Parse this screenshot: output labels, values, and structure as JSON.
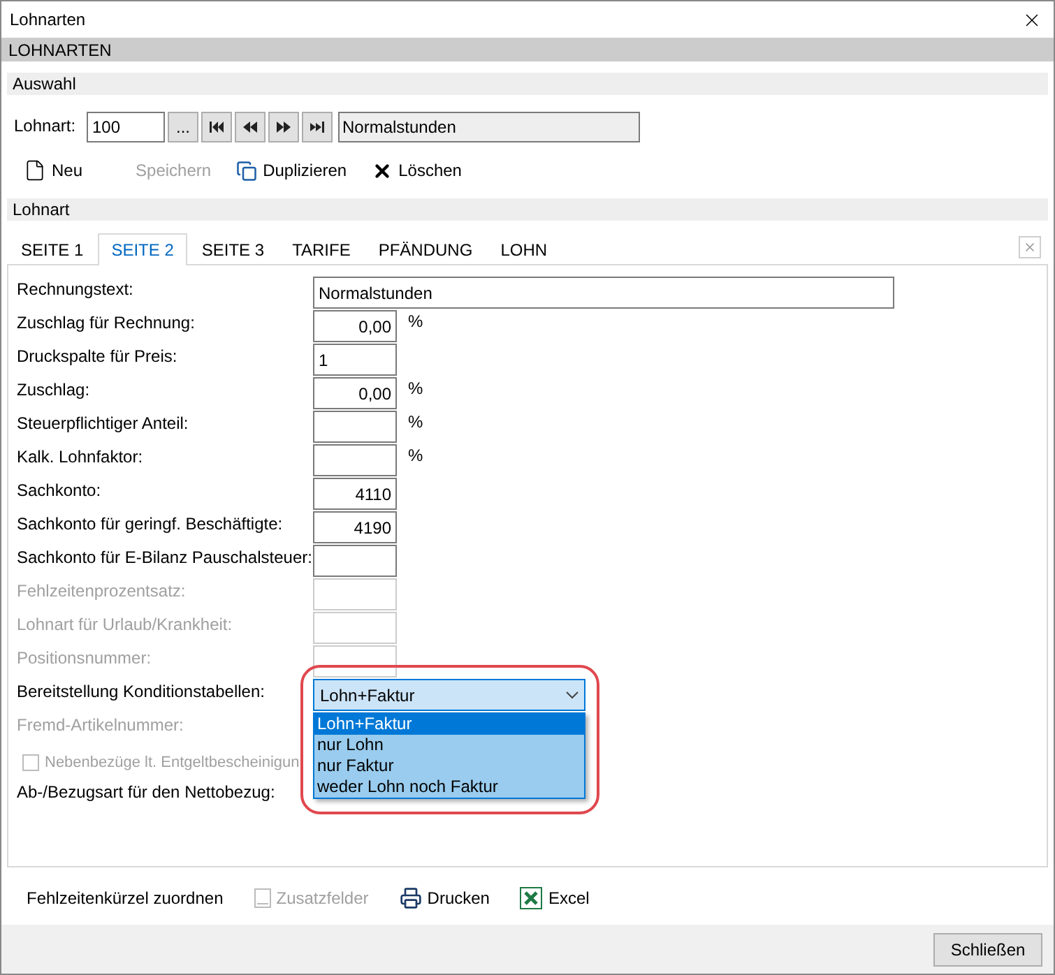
{
  "window": {
    "title": "Lohnarten"
  },
  "header": "LOHNARTEN",
  "selection": {
    "title": "Auswahl",
    "label": "Lohnart:",
    "number": "100",
    "browse": "...",
    "name": "Normalstunden"
  },
  "toolbar": [
    {
      "kind": "new",
      "label": "Neu",
      "disabled": false
    },
    {
      "kind": "plain",
      "label": "Speichern",
      "disabled": true
    },
    {
      "kind": "copy",
      "label": "Duplizieren",
      "disabled": false
    },
    {
      "kind": "delete",
      "label": "Löschen",
      "disabled": false
    }
  ],
  "section": "Lohnart",
  "tabs": [
    {
      "label": "SEITE 1",
      "selected": false
    },
    {
      "label": "SEITE 2",
      "selected": true
    },
    {
      "label": "SEITE 3",
      "selected": false
    },
    {
      "label": "TARIFE",
      "selected": false
    },
    {
      "label": "PFÄNDUNG",
      "selected": false
    },
    {
      "label": "LOHN",
      "selected": false
    }
  ],
  "form": [
    {
      "kind": "input",
      "label": "Rechnungstext:",
      "value": "Normalstunden",
      "wide": true,
      "disabled": false
    },
    {
      "kind": "input",
      "label": "Zuschlag für Rechnung:",
      "value": "0,00",
      "right_aligned": true,
      "unit": "%",
      "disabled": false
    },
    {
      "kind": "input",
      "label": "Druckspalte für Preis:",
      "value": "1",
      "disabled": false
    },
    {
      "kind": "input",
      "label": "Zuschlag:",
      "value": "0,00",
      "right_aligned": true,
      "unit": "%",
      "disabled": false
    },
    {
      "kind": "input",
      "label": "Steuerpflichtiger Anteil:",
      "unit": "%",
      "disabled": false
    },
    {
      "kind": "input",
      "label": "Kalk. Lohnfaktor:",
      "unit": "%",
      "disabled": false
    },
    {
      "kind": "input",
      "label": "Sachkonto:",
      "value": "4110",
      "right_aligned": true,
      "disabled": false
    },
    {
      "kind": "input",
      "label": "Sachkonto für geringf. Beschäftigte:",
      "value": "4190",
      "right_aligned": true,
      "disabled": false
    },
    {
      "kind": "input",
      "label": "Sachkonto für E-Bilanz Pauschalsteuer:",
      "disabled": false
    },
    {
      "kind": "input",
      "label": "Fehlzeitenprozentsatz:",
      "disabled": true
    },
    {
      "kind": "input",
      "label": "Lohnart für Urlaub/Krankheit:",
      "disabled": true
    },
    {
      "kind": "input",
      "label": "Positionsnummer:",
      "disabled": true
    },
    {
      "kind": "combo",
      "label": "Bereitstellung Konditionstabellen:",
      "value": "Lohn+Faktur",
      "disabled": false,
      "expanded": true,
      "options": [
        {
          "label": "Lohn+Faktur",
          "selected": true
        },
        {
          "label": "nur Lohn",
          "selected": false
        },
        {
          "label": "nur Faktur",
          "selected": false
        },
        {
          "label": "weder Lohn noch Faktur",
          "selected": false
        }
      ]
    },
    {
      "kind": "text",
      "label": "Fremd-Artikelnummer:",
      "disabled": true
    },
    {
      "kind": "checkbox",
      "label": "Nebenbezüge lt. Entgeltbescheinigun",
      "checked": false,
      "disabled": true
    },
    {
      "kind": "text",
      "label": "Ab-/Bezugsart für den Nettobezug:",
      "disabled": false
    }
  ],
  "actions": [
    {
      "kind": "plain",
      "label": "Fehlzeitenkürzel zuordnen",
      "disabled": false
    },
    {
      "kind": "fields",
      "label": "Zusatzfelder",
      "disabled": true
    },
    {
      "kind": "print",
      "label": "Drucken",
      "disabled": false
    },
    {
      "kind": "excel",
      "label": "Excel",
      "disabled": false
    }
  ],
  "close_button": "Schließen"
}
